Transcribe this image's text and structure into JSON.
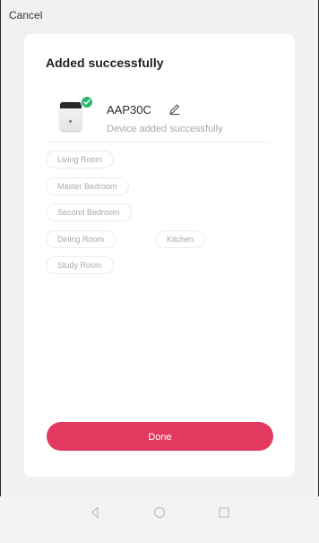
{
  "header": {
    "cancel_label": "Cancel"
  },
  "card": {
    "title": "Added successfully",
    "device": {
      "name": "AAP30C",
      "status": "Device added successfully"
    },
    "rooms": [
      "Living Room",
      "Master Bedroom",
      "Second Bedroom",
      "Dining Room",
      "Kitchen",
      "Study Room"
    ],
    "done_label": "Done"
  },
  "colors": {
    "accent": "#e3395f",
    "success": "#2ab56b",
    "chip_text": "#a9a9a9"
  },
  "nav": {
    "icons": [
      "back-triangle-icon",
      "home-circle-icon",
      "recents-square-icon"
    ]
  }
}
